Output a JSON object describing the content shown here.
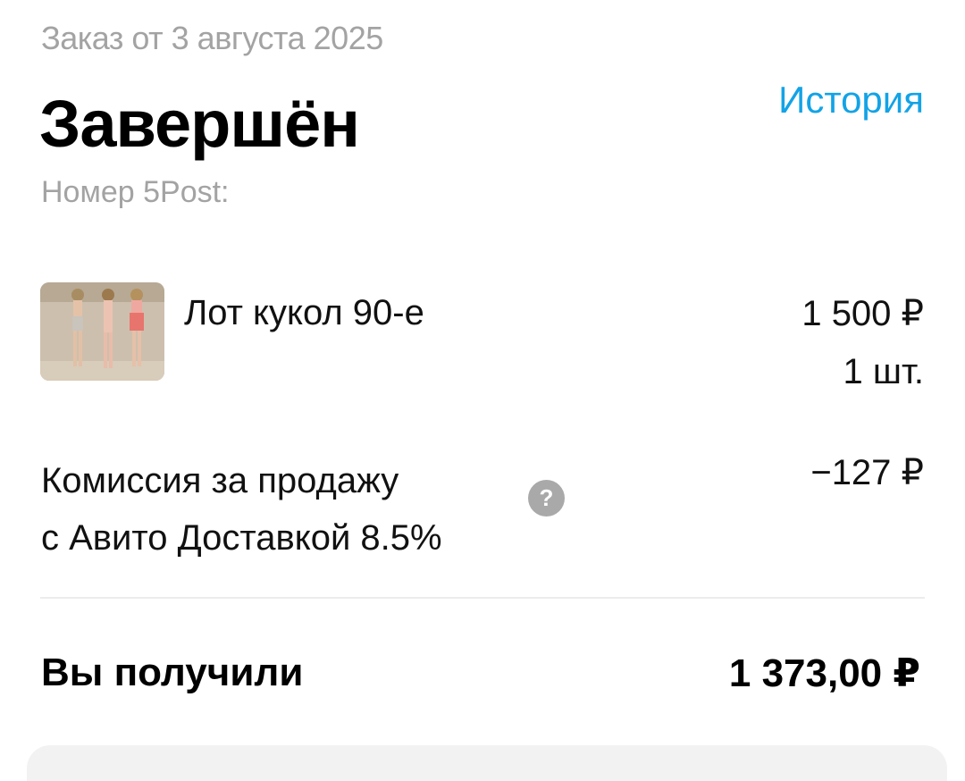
{
  "order": {
    "date_line": "Заказ от 3 августа 2025",
    "status": "Завершён",
    "history_link": "История",
    "tracking_label": "Номер 5Post:"
  },
  "item": {
    "name": "Лот кукол 90-е",
    "price": "1 500 ₽",
    "quantity": "1 шт.",
    "image_icon": "product-photo-dolls"
  },
  "commission": {
    "label_line1": "Комиссия за продажу",
    "label_line2": "с Авито Доставкой 8.5%",
    "value": "−127 ₽",
    "help_icon_glyph": "?"
  },
  "total": {
    "label": "Вы получили",
    "value": "1 373,00 ₽"
  },
  "colors": {
    "accent_link": "#13a3e6",
    "muted_text": "#a3a3a3",
    "help_icon_bg": "#a9a9a9",
    "divider": "#ececec"
  }
}
